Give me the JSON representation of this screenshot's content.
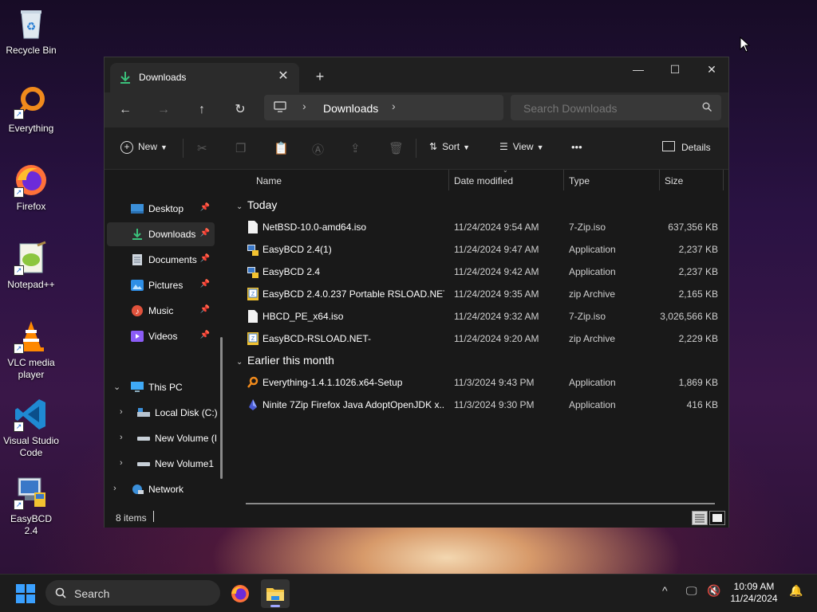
{
  "desktop": {
    "icons": [
      {
        "label": "Recycle Bin"
      },
      {
        "label": "Everything"
      },
      {
        "label": "Firefox"
      },
      {
        "label": "Notepad++"
      },
      {
        "label": "VLC media player"
      },
      {
        "label": "Visual Studio Code"
      },
      {
        "label": "EasyBCD 2.4"
      }
    ]
  },
  "window": {
    "tab_title": "Downloads",
    "new_tab": "+",
    "controls": {
      "minimize": "—",
      "maximize": "☐",
      "close": "✕"
    },
    "nav": {
      "back": "←",
      "forward": "→",
      "up": "↑",
      "refresh": "↻"
    },
    "address": {
      "crumb": "Downloads"
    },
    "search": {
      "placeholder": "Search Downloads"
    },
    "commands": {
      "new": "New",
      "sort": "Sort",
      "view": "View",
      "more": "•••",
      "details": "Details"
    },
    "sidebar": {
      "quick_access": [
        {
          "label": "Desktop",
          "selected": false
        },
        {
          "label": "Downloads",
          "selected": true
        },
        {
          "label": "Documents",
          "selected": false
        },
        {
          "label": "Pictures",
          "selected": false
        },
        {
          "label": "Music",
          "selected": false
        },
        {
          "label": "Videos",
          "selected": false
        }
      ],
      "this_pc": "This PC",
      "drives": [
        {
          "label": "Local Disk (C:)"
        },
        {
          "label": "New Volume (I"
        },
        {
          "label": "New Volume1"
        }
      ],
      "network": "Network"
    },
    "columns": {
      "name": "Name",
      "date": "Date modified",
      "type": "Type",
      "size": "Size"
    },
    "groups": [
      {
        "label": "Today",
        "files": [
          {
            "name": "NetBSD-10.0-amd64.iso",
            "date": "11/24/2024 9:54 AM",
            "type": "7-Zip.iso",
            "size": "637,356 KB",
            "icon": "file-icon"
          },
          {
            "name": "EasyBCD 2.4(1)",
            "date": "11/24/2024 9:47 AM",
            "type": "Application",
            "size": "2,237 KB",
            "icon": "installer-icon"
          },
          {
            "name": "EasyBCD 2.4",
            "date": "11/24/2024 9:42 AM",
            "type": "Application",
            "size": "2,237 KB",
            "icon": "installer-icon"
          },
          {
            "name": "EasyBCD 2.4.0.237 Portable RSLOAD.NET",
            "date": "11/24/2024 9:35 AM",
            "type": "zip Archive",
            "size": "2,165 KB",
            "icon": "archive-icon"
          },
          {
            "name": "HBCD_PE_x64.iso",
            "date": "11/24/2024 9:32 AM",
            "type": "7-Zip.iso",
            "size": "3,026,566 KB",
            "icon": "file-icon"
          },
          {
            "name": "EasyBCD-RSLOAD.NET-",
            "date": "11/24/2024 9:20 AM",
            "type": "zip Archive",
            "size": "2,229 KB",
            "icon": "archive-icon"
          }
        ]
      },
      {
        "label": "Earlier this month",
        "files": [
          {
            "name": "Everything-1.4.1.1026.x64-Setup",
            "date": "11/3/2024 9:43 PM",
            "type": "Application",
            "size": "1,869 KB",
            "icon": "search-app-icon"
          },
          {
            "name": "Ninite 7Zip Firefox Java AdoptOpenJDK x...",
            "date": "11/3/2024 9:30 PM",
            "type": "Application",
            "size": "416 KB",
            "icon": "ninite-icon"
          }
        ]
      }
    ],
    "status": {
      "item_count": "8 items"
    }
  },
  "taskbar": {
    "search_label": "Search",
    "time": "10:09 AM",
    "date": "11/24/2024"
  },
  "colors": {
    "accent": "#0078d4",
    "window_bg": "#191919",
    "taskbar_bg": "#1c1c1c"
  }
}
